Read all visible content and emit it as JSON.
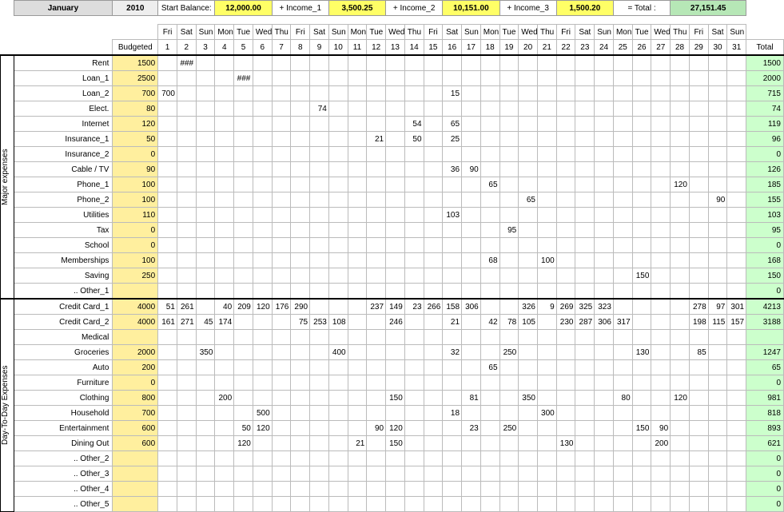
{
  "header": {
    "month": "January",
    "year": "2010",
    "start_balance_label": "Start Balance:",
    "start_balance": "12,000.00",
    "income1_label": "+ Income_1",
    "income1": "3,500.25",
    "income2_label": "+ Income_2",
    "income2": "10,151.00",
    "income3_label": "+ Income_3",
    "income3": "1,500.20",
    "total_label": "= Total :",
    "total": "27,151.45"
  },
  "columns": {
    "budgeted": "Budgeted",
    "total": "Total",
    "dow": [
      "Fri",
      "Sat",
      "Sun",
      "Mon",
      "Tue",
      "Wed",
      "Thu",
      "Fri",
      "Sat",
      "Sun",
      "Mon",
      "Tue",
      "Wed",
      "Thu",
      "Fri",
      "Sat",
      "Sun",
      "Mon",
      "Tue",
      "Wed",
      "Thu",
      "Fri",
      "Sat",
      "Sun",
      "Mon",
      "Tue",
      "Wed",
      "Thu",
      "Fri",
      "Sat",
      "Sun"
    ],
    "nums": [
      "1",
      "2",
      "3",
      "4",
      "5",
      "6",
      "7",
      "8",
      "9",
      "10",
      "11",
      "12",
      "13",
      "14",
      "15",
      "16",
      "17",
      "18",
      "19",
      "20",
      "21",
      "22",
      "23",
      "24",
      "25",
      "26",
      "27",
      "28",
      "29",
      "30",
      "31"
    ]
  },
  "sections": [
    {
      "title": "Major expenses",
      "rows": [
        {
          "label": "Rent",
          "budget": "1500",
          "total": "1500",
          "cells": {
            "2": "###"
          }
        },
        {
          "label": "Loan_1",
          "budget": "2500",
          "total": "2000",
          "cells": {
            "5": "###"
          }
        },
        {
          "label": "Loan_2",
          "budget": "700",
          "total": "715",
          "cells": {
            "1": "700",
            "16": "15"
          }
        },
        {
          "label": "Elect.",
          "budget": "80",
          "total": "74",
          "cells": {
            "9": "74"
          }
        },
        {
          "label": "Internet",
          "budget": "120",
          "total": "119",
          "cells": {
            "14": "54",
            "16": "65"
          }
        },
        {
          "label": "Insurance_1",
          "budget": "50",
          "total": "96",
          "cells": {
            "12": "21",
            "14": "50",
            "16": "25"
          }
        },
        {
          "label": "Insurance_2",
          "budget": "0",
          "total": "0",
          "cells": {}
        },
        {
          "label": "Cable / TV",
          "budget": "90",
          "total": "126",
          "cells": {
            "16": "36",
            "17": "90"
          }
        },
        {
          "label": "Phone_1",
          "budget": "100",
          "total": "185",
          "cells": {
            "18": "65",
            "28": "120"
          }
        },
        {
          "label": "Phone_2",
          "budget": "100",
          "total": "155",
          "cells": {
            "20": "65",
            "30": "90"
          }
        },
        {
          "label": "Utilities",
          "budget": "110",
          "total": "103",
          "cells": {
            "16": "103"
          }
        },
        {
          "label": "Tax",
          "budget": "0",
          "total": "95",
          "cells": {
            "19": "95"
          }
        },
        {
          "label": "School",
          "budget": "0",
          "total": "0",
          "cells": {}
        },
        {
          "label": "Memberships",
          "budget": "100",
          "total": "168",
          "cells": {
            "18": "68",
            "21": "100"
          }
        },
        {
          "label": "Saving",
          "budget": "250",
          "total": "150",
          "cells": {
            "26": "150"
          }
        },
        {
          "label": ".. Other_1",
          "budget": "",
          "total": "0",
          "cells": {}
        }
      ]
    },
    {
      "title": "Day-To-Day Expenses",
      "rows": [
        {
          "label": "Credit Card_1",
          "budget": "4000",
          "total": "4213",
          "cells": {
            "1": "51",
            "2": "261",
            "4": "40",
            "5": "209",
            "6": "120",
            "7": "176",
            "8": "290",
            "12": "237",
            "13": "149",
            "14": "23",
            "15": "266",
            "16": "158",
            "17": "306",
            "20": "326",
            "21": "9",
            "22": "269",
            "23": "325",
            "24": "323",
            "29": "278",
            "30": "97",
            "31": "301"
          }
        },
        {
          "label": "Credit Card_2",
          "budget": "4000",
          "total": "3188",
          "cells": {
            "1": "161",
            "2": "271",
            "3": "45",
            "4": "174",
            "8": "75",
            "9": "253",
            "10": "108",
            "13": "246",
            "16": "21",
            "18": "42",
            "19": "78",
            "20": "105",
            "22": "230",
            "23": "287",
            "24": "306",
            "25": "317",
            "29": "198",
            "30": "115",
            "31": "157"
          }
        },
        {
          "label": "Medical",
          "budget": "",
          "total": "",
          "cells": {}
        },
        {
          "label": "Groceries",
          "budget": "2000",
          "total": "1247",
          "cells": {
            "3": "350",
            "10": "400",
            "16": "32",
            "19": "250",
            "26": "130",
            "29": "85"
          }
        },
        {
          "label": "Auto",
          "budget": "200",
          "total": "65",
          "cells": {
            "18": "65"
          }
        },
        {
          "label": "Furniture",
          "budget": "0",
          "total": "0",
          "cells": {}
        },
        {
          "label": "Clothing",
          "budget": "800",
          "total": "981",
          "cells": {
            "4": "200",
            "13": "150",
            "17": "81",
            "20": "350",
            "25": "80",
            "28": "120"
          }
        },
        {
          "label": "Household",
          "budget": "700",
          "total": "818",
          "cells": {
            "6": "500",
            "16": "18",
            "21": "300"
          }
        },
        {
          "label": "Entertainment",
          "budget": "600",
          "total": "893",
          "cells": {
            "5": "50",
            "6": "120",
            "12": "90",
            "13": "120",
            "17": "23",
            "19": "250",
            "26": "150",
            "27": "90"
          }
        },
        {
          "label": "Dining Out",
          "budget": "600",
          "total": "621",
          "cells": {
            "5": "120",
            "11": "21",
            "13": "150",
            "22": "130",
            "27": "200"
          }
        },
        {
          "label": ".. Other_2",
          "budget": "",
          "total": "0",
          "cells": {}
        },
        {
          "label": ".. Other_3",
          "budget": "",
          "total": "0",
          "cells": {}
        },
        {
          "label": ".. Other_4",
          "budget": "",
          "total": "0",
          "cells": {}
        },
        {
          "label": ".. Other_5",
          "budget": "",
          "total": "0",
          "cells": {}
        }
      ]
    }
  ]
}
